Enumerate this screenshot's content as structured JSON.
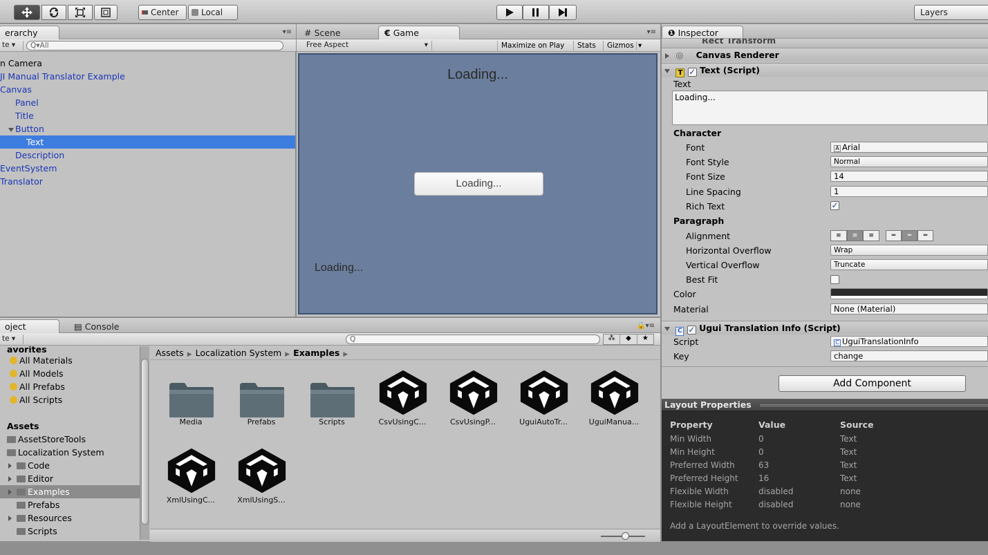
{
  "toolbar": {
    "pivot_center": "Center",
    "pivot_local": "Local",
    "layers": "Layers",
    "play_icon": "play-icon",
    "pause_icon": "pause-icon",
    "step_icon": "step-icon"
  },
  "hierarchy": {
    "tab": "erarchy",
    "create": "te",
    "search_placeholder": "All",
    "items": [
      {
        "label": "n Camera",
        "indent": 0,
        "blue": false,
        "selected": false
      },
      {
        "label": "JI Manual Translator Example",
        "indent": 0,
        "blue": true,
        "selected": false
      },
      {
        "label": "Canvas",
        "indent": 0,
        "blue": true,
        "selected": false
      },
      {
        "label": "Panel",
        "indent": 1,
        "blue": true,
        "selected": false
      },
      {
        "label": "Title",
        "indent": 1,
        "blue": true,
        "selected": false
      },
      {
        "label": "Button",
        "indent": 1,
        "blue": true,
        "selected": false
      },
      {
        "label": "Text",
        "indent": 2,
        "blue": true,
        "selected": true
      },
      {
        "label": "Description",
        "indent": 1,
        "blue": true,
        "selected": false
      },
      {
        "label": "EventSystem",
        "indent": 0,
        "blue": true,
        "selected": false
      },
      {
        "label": "Translator",
        "indent": 0,
        "blue": true,
        "selected": false
      }
    ]
  },
  "scene_tabs": {
    "scene": "Scene",
    "game": "Game",
    "aspect": "Free Aspect",
    "maximize": "Maximize on Play",
    "stats": "Stats",
    "gizmos": "Gizmos"
  },
  "game": {
    "title": "Loading...",
    "button": "Loading...",
    "bottom": "Loading..."
  },
  "inspector": {
    "tab": "Inspector",
    "rect_transform": "Rect Transform",
    "canvas_renderer": "Canvas Renderer",
    "text_script": "Text (Script)",
    "text_label": "Text",
    "text_value": "Loading...",
    "character": "Character",
    "font_label": "Font",
    "font_value": "Arial",
    "font_style_label": "Font Style",
    "font_style_value": "Normal",
    "font_size_label": "Font Size",
    "font_size_value": "14",
    "line_spacing_label": "Line Spacing",
    "line_spacing_value": "1",
    "rich_text_label": "Rich Text",
    "paragraph": "Paragraph",
    "alignment_label": "Alignment",
    "h_overflow_label": "Horizontal Overflow",
    "h_overflow_value": "Wrap",
    "v_overflow_label": "Vertical Overflow",
    "v_overflow_value": "Truncate",
    "best_fit_label": "Best Fit",
    "color_label": "Color",
    "color_value": "#2a2a2a",
    "material_label": "Material",
    "material_value": "None (Material)",
    "ugui_script": "Ugui Translation Info (Script)",
    "script_label": "Script",
    "script_value": "UguiTranslationInfo",
    "key_label": "Key",
    "key_value": "change",
    "add_component": "Add Component"
  },
  "layout_properties": {
    "title": "Layout Properties",
    "headers": [
      "Property",
      "Value",
      "Source"
    ],
    "rows": [
      [
        "Min Width",
        "0",
        "Text"
      ],
      [
        "Min Height",
        "0",
        "Text"
      ],
      [
        "Preferred Width",
        "63",
        "Text"
      ],
      [
        "Preferred Height",
        "16",
        "Text"
      ],
      [
        "Flexible Width",
        "disabled",
        "none"
      ],
      [
        "Flexible Height",
        "disabled",
        "none"
      ]
    ],
    "note": "Add a LayoutElement to override values."
  },
  "project": {
    "tab": "oject",
    "console_tab": "Console",
    "create": "te",
    "favorites_title": "avorites",
    "favorites": [
      "All Materials",
      "All Models",
      "All Prefabs",
      "All Scripts"
    ],
    "assets_title": "Assets",
    "tree": [
      {
        "label": "AssetStoreTools",
        "indent": 0,
        "selected": false
      },
      {
        "label": "Localization System",
        "indent": 0,
        "selected": false
      },
      {
        "label": "Code",
        "indent": 1,
        "selected": false
      },
      {
        "label": "Editor",
        "indent": 1,
        "selected": false
      },
      {
        "label": "Examples",
        "indent": 1,
        "selected": true
      },
      {
        "label": "Prefabs",
        "indent": 1,
        "selected": false
      },
      {
        "label": "Resources",
        "indent": 1,
        "selected": false
      },
      {
        "label": "Scripts",
        "indent": 1,
        "selected": false
      }
    ],
    "breadcrumb": [
      "Assets",
      "Localization System",
      "Examples"
    ],
    "assets": [
      {
        "name": "Media",
        "kind": "folder"
      },
      {
        "name": "Prefabs",
        "kind": "folder"
      },
      {
        "name": "Scripts",
        "kind": "folder"
      },
      {
        "name": "CsvUsingC...",
        "kind": "unity"
      },
      {
        "name": "CsvUsingP...",
        "kind": "unity"
      },
      {
        "name": "UguiAutoTr...",
        "kind": "unity"
      },
      {
        "name": "UguiManua...",
        "kind": "unity"
      },
      {
        "name": "XmlUsingC...",
        "kind": "unity"
      },
      {
        "name": "XmlUsingS...",
        "kind": "unity"
      }
    ]
  }
}
